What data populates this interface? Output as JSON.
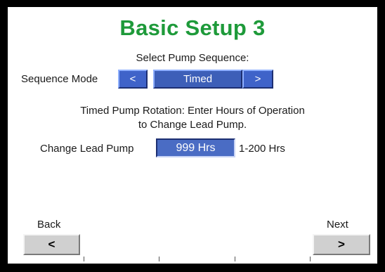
{
  "screen": {
    "title": "Basic Setup 3",
    "select_prompt": "Select Pump Sequence:",
    "sequence_mode": {
      "label": "Sequence Mode",
      "prev_glyph": "<",
      "value": "Timed",
      "next_glyph": ">"
    },
    "description_line1": "Timed  Pump Rotation: Enter Hours of Operation",
    "description_line2": "to Change Lead Pump.",
    "change_lead_pump": {
      "label": "Change Lead Pump",
      "value": "999 Hrs",
      "range": "1-200 Hrs"
    },
    "back": {
      "label": "Back",
      "glyph": "<"
    },
    "next": {
      "label": "Next",
      "glyph": ">"
    }
  },
  "colors": {
    "title": "#1e9a3a",
    "button_blue": "#3f63c9",
    "button_gray": "#d0d0d0",
    "frame": "#000000"
  }
}
